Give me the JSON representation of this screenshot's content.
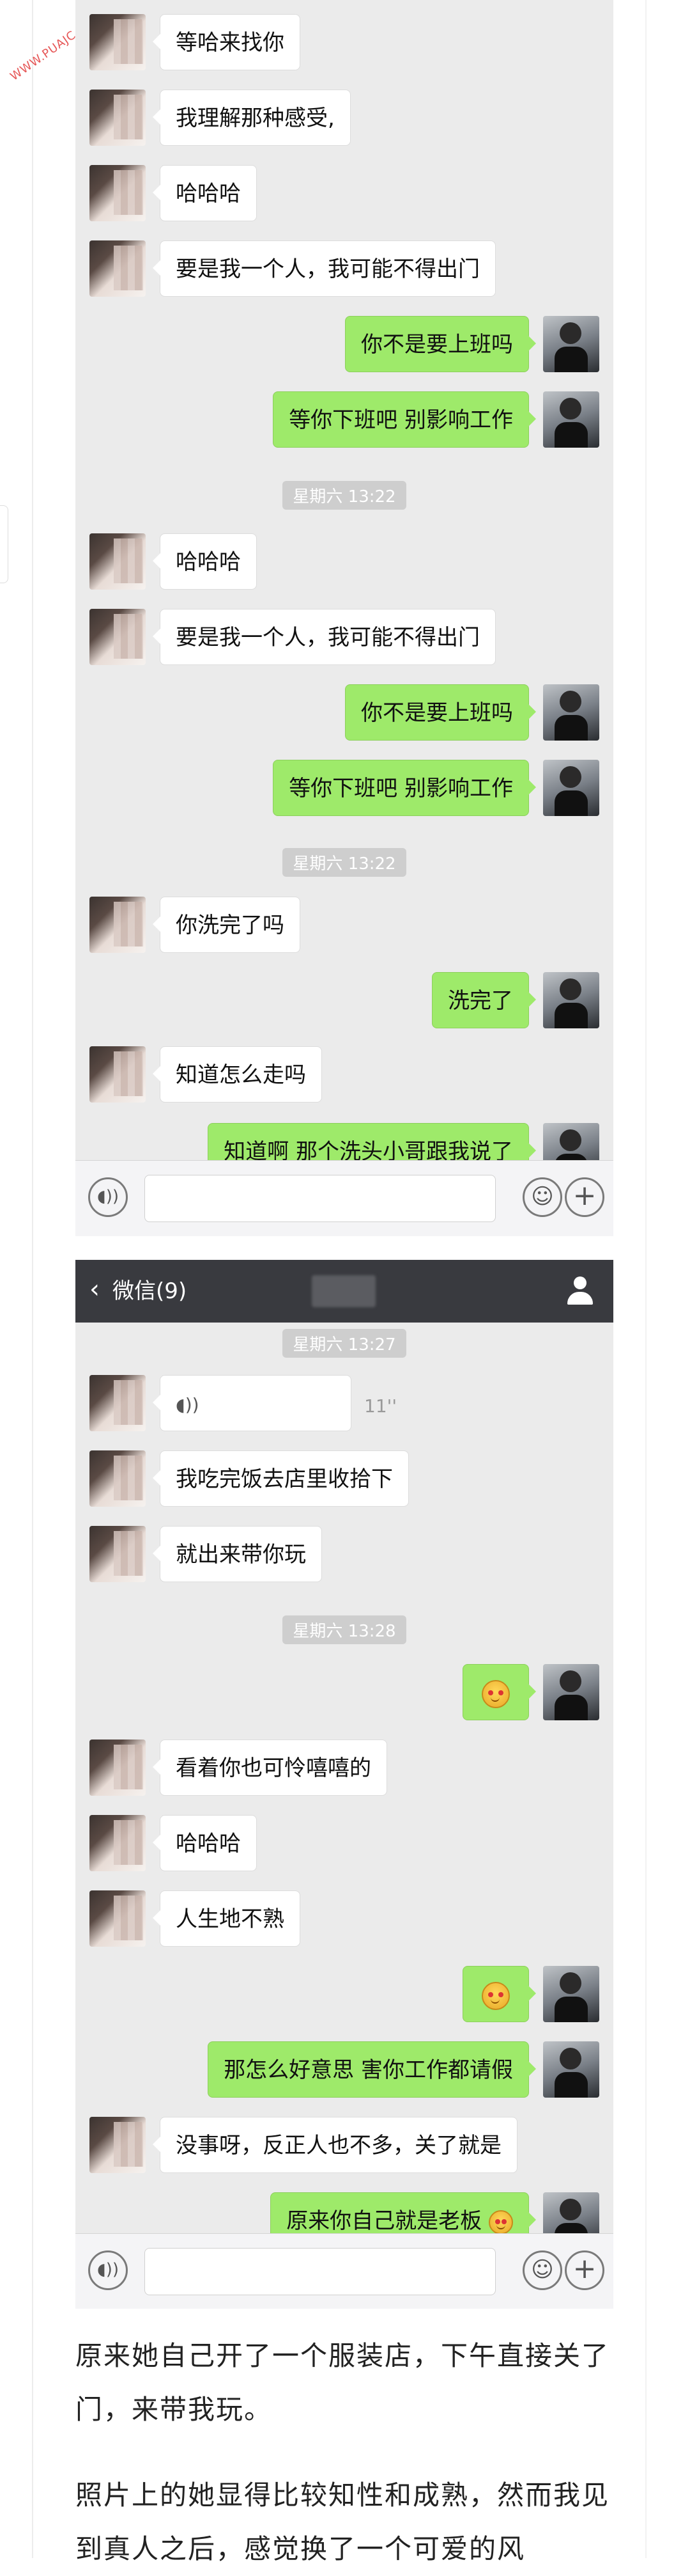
{
  "watermark": "WWW.PUAJC.COM真实案例学习 WWW.PU",
  "screenshot1": {
    "messages": [
      {
        "side": "left",
        "text": "等哈来找你"
      },
      {
        "side": "left",
        "text": "我理解那种感受,"
      },
      {
        "side": "left",
        "text": "哈哈哈"
      },
      {
        "side": "left",
        "text": "要是我一个人，我可能不得出门"
      },
      {
        "side": "right",
        "text": "你不是要上班吗"
      },
      {
        "side": "right",
        "text": "等你下班吧 别影响工作"
      },
      {
        "timestamp": "星期六 13:22"
      },
      {
        "side": "left",
        "text": "哈哈哈"
      },
      {
        "side": "left",
        "text": "要是我一个人，我可能不得出门"
      },
      {
        "side": "right",
        "text": "你不是要上班吗"
      },
      {
        "side": "right",
        "text": "等你下班吧 别影响工作"
      },
      {
        "timestamp": "星期六 13:22"
      },
      {
        "side": "left",
        "text": "你洗完了吗"
      },
      {
        "side": "right",
        "text": "洗完了"
      },
      {
        "side": "left",
        "text": "知道怎么走吗"
      },
      {
        "side": "right",
        "text": "知道啊 那个洗头小哥跟我说了"
      }
    ]
  },
  "screenshot2": {
    "header": {
      "back_label": "微信(9)"
    },
    "messages": [
      {
        "timestamp": "星期六 13:27"
      },
      {
        "side": "left",
        "voice": true,
        "duration": "11''"
      },
      {
        "side": "left",
        "text": "我吃完饭去店里收拾下"
      },
      {
        "side": "left",
        "text": "就出来带你玩"
      },
      {
        "timestamp": "星期六 13:28"
      },
      {
        "side": "right",
        "emoji": "blush-emoji"
      },
      {
        "side": "left",
        "text": "看着你也可怜嘻嘻的"
      },
      {
        "side": "left",
        "text": "哈哈哈"
      },
      {
        "side": "left",
        "text": "人生地不熟"
      },
      {
        "side": "right",
        "emoji": "heart-eyes-emoji"
      },
      {
        "side": "right",
        "text": "那怎么好意思 害你工作都请假"
      },
      {
        "side": "left",
        "text": "没事呀，反正人也不多，关了就是"
      },
      {
        "side": "right",
        "text": "原来你自己就是老板",
        "emoji": "laugh-emoji"
      }
    ]
  },
  "article": {
    "paragraph1": "原来她自己开了一个服装店，下午直接关了门，来带我玩。",
    "paragraph2": "照片上的她显得比较知性和成熟，然而我见到真人之后，感觉换了一个可爱的风"
  }
}
